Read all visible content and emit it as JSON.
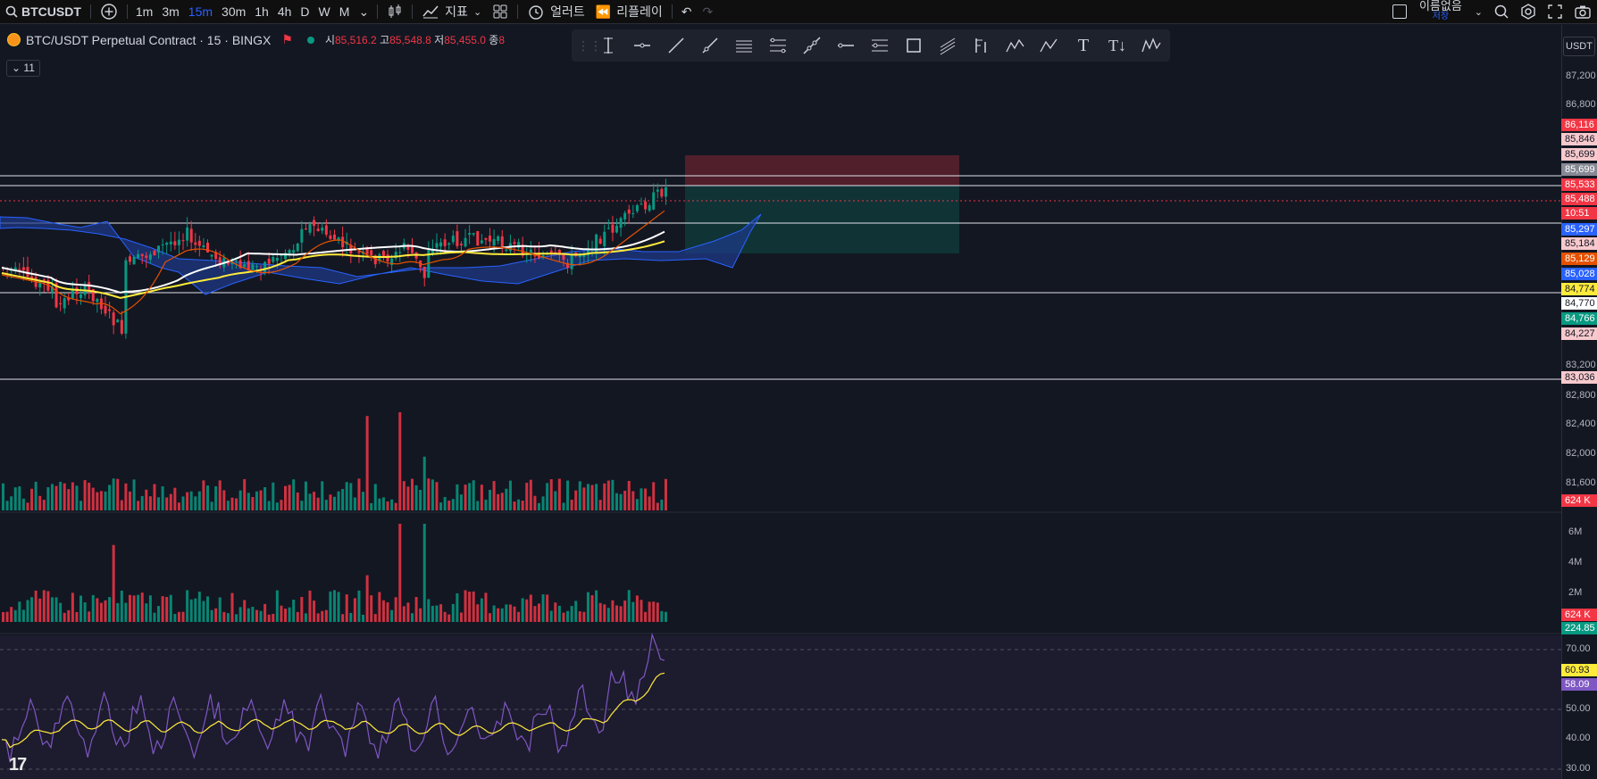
{
  "topbar": {
    "symbol": "BTCUSDT",
    "intervals": [
      "1m",
      "3m",
      "15m",
      "30m",
      "1h",
      "4h",
      "D",
      "W",
      "M"
    ],
    "active_interval": "15m",
    "indicators_label": "지표",
    "alert_label": "얼러트",
    "replay_label": "리플레이",
    "layout_name": "이름없음",
    "layout_status": "저장"
  },
  "legend": {
    "title": "BTC/USDT Perpetual Contract · 15 · BINGX",
    "open_label": "시",
    "open": "85,516.2",
    "high_label": "고",
    "high": "85,548.8",
    "low_label": "저",
    "low": "85,455.0",
    "close_label": "종",
    "close": "8"
  },
  "indicator_count": "11",
  "price_scale": {
    "currency": "USDT",
    "ticks": [
      "87,200",
      "86,800",
      "83,200",
      "82,800",
      "82,400",
      "82,000",
      "81,600"
    ],
    "badges": [
      {
        "text": "86,116",
        "bg": "#f23645",
        "fg": "#ffffff"
      },
      {
        "text": "85,846",
        "bg": "#f7c9cd",
        "fg": "#131722"
      },
      {
        "text": "85,699",
        "bg": "#f7c9cd",
        "fg": "#131722"
      },
      {
        "text": "85,699",
        "bg": "#868993",
        "fg": "#ffffff"
      },
      {
        "text": "85,533",
        "bg": "#f23645",
        "fg": "#ffffff"
      },
      {
        "text": "85,488",
        "bg": "#f23645",
        "fg": "#ffffff"
      },
      {
        "text": "10:51",
        "bg": "#f23645",
        "fg": "#ffffff"
      },
      {
        "text": "85,297",
        "bg": "#2962ff",
        "fg": "#ffffff"
      },
      {
        "text": "85,184",
        "bg": "#f7c9cd",
        "fg": "#131722"
      },
      {
        "text": "85,129",
        "bg": "#e65100",
        "fg": "#ffffff"
      },
      {
        "text": "85,028",
        "bg": "#2962ff",
        "fg": "#ffffff"
      },
      {
        "text": "84,774",
        "bg": "#ffeb3b",
        "fg": "#131722"
      },
      {
        "text": "84,770",
        "bg": "#ffffff",
        "fg": "#131722"
      },
      {
        "text": "84,766",
        "bg": "#089981",
        "fg": "#ffffff"
      },
      {
        "text": "84,227",
        "bg": "#f7c9cd",
        "fg": "#131722"
      },
      {
        "text": "83,036",
        "bg": "#f7c9cd",
        "fg": "#131722"
      }
    ]
  },
  "volume_pane": {
    "badge": "624 K"
  },
  "volume2_pane": {
    "ticks": [
      "6M",
      "4M",
      "2M"
    ],
    "badge1": "624 K",
    "badge2": "224.85"
  },
  "rsi_pane": {
    "ticks": [
      "70.00",
      "50.00",
      "40.00",
      "30.00"
    ],
    "value_ma": "60.93",
    "value_rsi": "58.09"
  },
  "colors": {
    "up": "#089981",
    "down": "#f23645",
    "accent": "#2962ff",
    "rsi": "#7e57c2",
    "rsi_ma": "#ffeb3b",
    "cloud": "#1e3a8a"
  }
}
